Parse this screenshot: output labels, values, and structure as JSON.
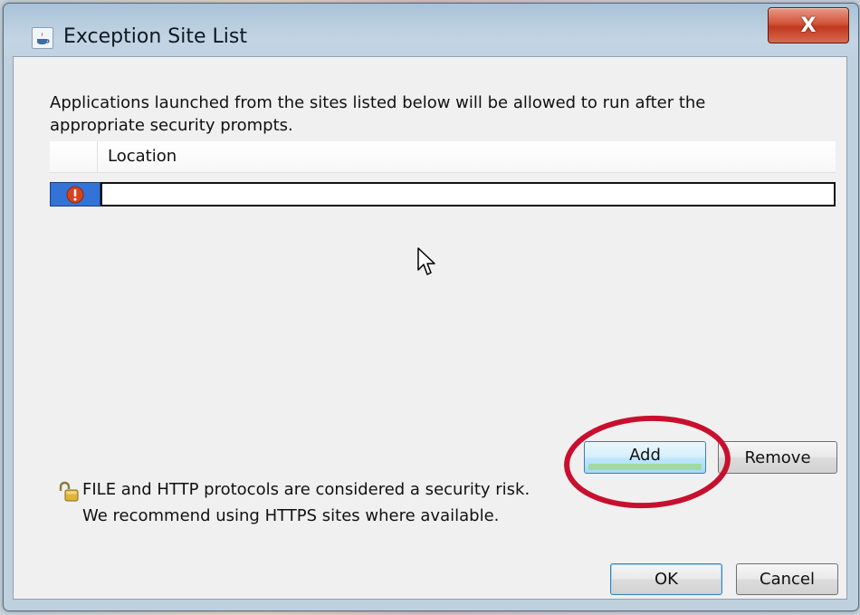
{
  "window": {
    "title": "Exception Site List",
    "close_symbol": "X"
  },
  "description": "Applications launched from the sites listed below will be allowed to run after the appropriate security prompts.",
  "table": {
    "columns": [
      "",
      "Location"
    ],
    "rows": [
      {
        "status_icon": "error-icon",
        "location": ""
      }
    ]
  },
  "buttons": {
    "add": "Add",
    "remove": "Remove",
    "ok": "OK",
    "cancel": "Cancel"
  },
  "warning": {
    "icon": "unlocked-padlock-icon",
    "line1": "FILE and HTTP protocols are considered a security risk.",
    "line2": "We recommend using HTTPS sites where available."
  },
  "colors": {
    "selection_blue": "#3372d6",
    "error_red": "#d8431d",
    "annotation_red": "#c8102e",
    "close_red": "#c0391f"
  }
}
